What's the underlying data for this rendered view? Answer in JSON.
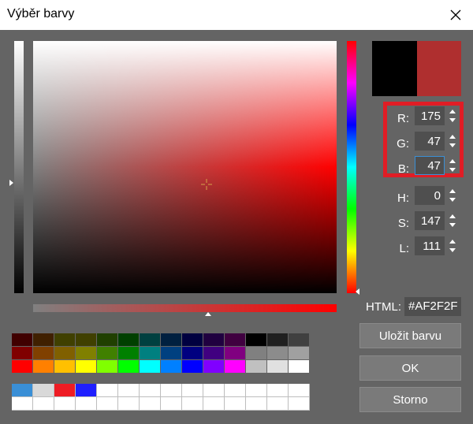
{
  "window": {
    "title": "Výběr barvy",
    "close_icon": "close-icon"
  },
  "preview": {
    "old_color": "#000000",
    "new_color": "#AF2F2F"
  },
  "rgb": {
    "r": {
      "label": "R:",
      "value": "175"
    },
    "g": {
      "label": "G:",
      "value": "47"
    },
    "b": {
      "label": "B:",
      "value": "47"
    }
  },
  "hsl": {
    "h": {
      "label": "H:",
      "value": "0"
    },
    "s": {
      "label": "S:",
      "value": "147"
    },
    "l": {
      "label": "L:",
      "value": "111"
    }
  },
  "html": {
    "label": "HTML:",
    "value": "#AF2F2F"
  },
  "buttons": {
    "save": "Uložit barvu",
    "ok": "OK",
    "cancel": "Storno"
  },
  "highlight_color": "#e01d25",
  "palette": [
    [
      "#400000",
      "#402000",
      "#404000",
      "#404000",
      "#204000",
      "#004000",
      "#004040",
      "#002040",
      "#000040",
      "#200040",
      "#400040",
      "#000000",
      "#202020",
      "#404040"
    ],
    [
      "#800000",
      "#804000",
      "#806000",
      "#808000",
      "#408000",
      "#008000",
      "#008080",
      "#004080",
      "#000080",
      "#400080",
      "#800080",
      "#808080",
      "#8c8c8c",
      "#a0a0a0"
    ],
    [
      "#ff0000",
      "#ff8000",
      "#ffc000",
      "#ffff00",
      "#80ff00",
      "#00ff00",
      "#00ffff",
      "#0080ff",
      "#0000ff",
      "#8000ff",
      "#ff00ff",
      "#c0c0c0",
      "#e0e0e0",
      "#ffffff"
    ]
  ],
  "custom_colors": [
    [
      "#3a8fd6",
      "#d9d9d9",
      "#ee1c24",
      "#1f1fff",
      "#ffffff",
      "#ffffff",
      "#ffffff",
      "#ffffff",
      "#ffffff",
      "#ffffff",
      "#ffffff",
      "#ffffff",
      "#ffffff",
      "#ffffff"
    ],
    [
      "#ffffff",
      "#ffffff",
      "#ffffff",
      "#ffffff",
      "#ffffff",
      "#ffffff",
      "#ffffff",
      "#ffffff",
      "#ffffff",
      "#ffffff",
      "#ffffff",
      "#ffffff",
      "#ffffff",
      "#ffffff"
    ]
  ]
}
